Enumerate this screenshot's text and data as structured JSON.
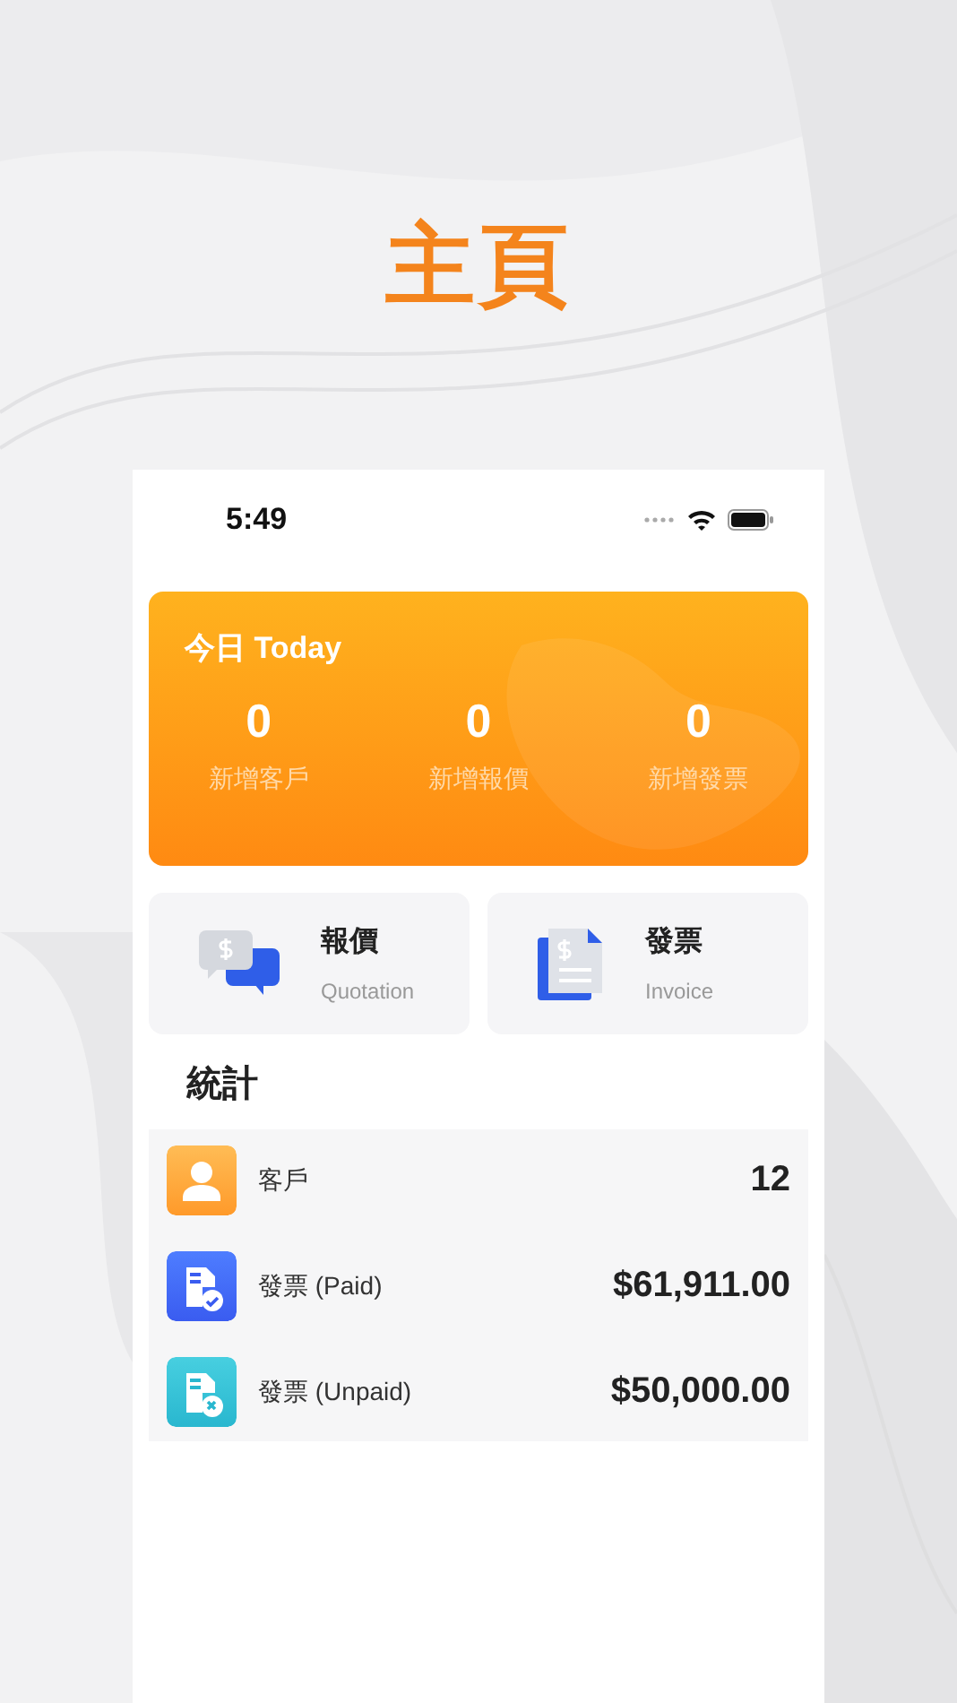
{
  "page_title": "主頁",
  "status_bar": {
    "time": "5:49"
  },
  "today": {
    "title": "今日 Today",
    "stats": [
      {
        "value": "0",
        "label": "新增客戶"
      },
      {
        "value": "0",
        "label": "新增報價"
      },
      {
        "value": "0",
        "label": "新增發票"
      }
    ]
  },
  "shortcuts": [
    {
      "kind": "quotation",
      "title": "報價",
      "subtitle": "Quotation"
    },
    {
      "kind": "invoice",
      "title": "發票",
      "subtitle": "Invoice"
    }
  ],
  "statistics": {
    "title": "統計",
    "rows": [
      {
        "kind": "customer",
        "label": "客戶",
        "value": "12"
      },
      {
        "kind": "paid",
        "label": "發票 (Paid)",
        "value": "$61,911.00"
      },
      {
        "kind": "unpaid",
        "label": "發票 (Unpaid)",
        "value": "$50,000.00"
      }
    ]
  }
}
